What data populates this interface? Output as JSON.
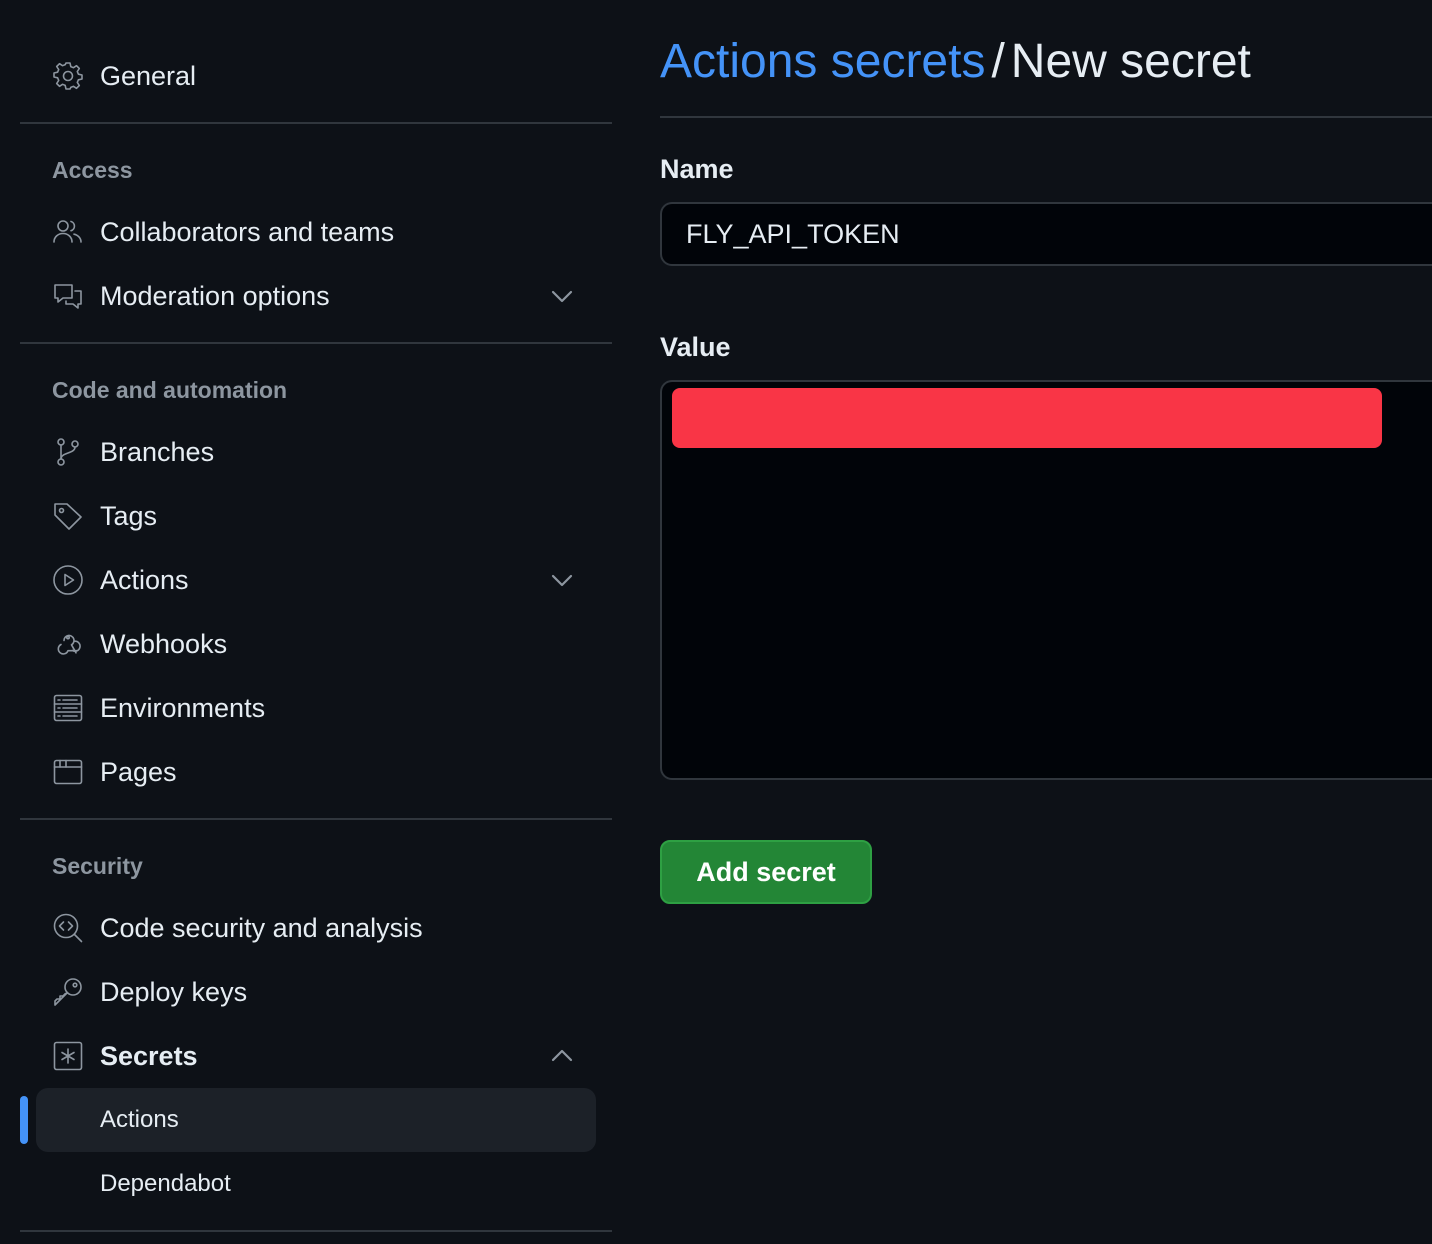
{
  "sidebar": {
    "general": {
      "label": "General",
      "icon": "gear-icon"
    },
    "sections": {
      "access": {
        "heading": "Access",
        "items": [
          {
            "label": "Collaborators and teams",
            "icon": "people-icon"
          },
          {
            "label": "Moderation options",
            "icon": "comment-discussion-icon",
            "expandable": true,
            "expanded": false
          }
        ]
      },
      "code_automation": {
        "heading": "Code and automation",
        "items": [
          {
            "label": "Branches",
            "icon": "git-branch-icon"
          },
          {
            "label": "Tags",
            "icon": "tag-icon"
          },
          {
            "label": "Actions",
            "icon": "play-icon",
            "expandable": true,
            "expanded": false
          },
          {
            "label": "Webhooks",
            "icon": "webhook-icon"
          },
          {
            "label": "Environments",
            "icon": "server-icon"
          },
          {
            "label": "Pages",
            "icon": "browser-icon"
          }
        ]
      },
      "security": {
        "heading": "Security",
        "items": [
          {
            "label": "Code security and analysis",
            "icon": "codescan-icon"
          },
          {
            "label": "Deploy keys",
            "icon": "key-icon"
          },
          {
            "label": "Secrets",
            "icon": "asterisk-box-icon",
            "expandable": true,
            "expanded": true
          }
        ],
        "secrets_subitems": [
          {
            "label": "Actions",
            "active": true
          },
          {
            "label": "Dependabot",
            "active": false
          }
        ]
      }
    }
  },
  "main": {
    "breadcrumb_link": "Actions secrets",
    "breadcrumb_separator": "/",
    "breadcrumb_current": "New secret",
    "name_label": "Name",
    "name_value": "FLY_API_TOKEN",
    "value_label": "Value",
    "add_button_label": "Add secret"
  },
  "colors": {
    "background": "#0d1117",
    "link": "#4493f8",
    "button": "#238636",
    "redaction": "#f93546",
    "active_indicator": "#4493f8"
  }
}
